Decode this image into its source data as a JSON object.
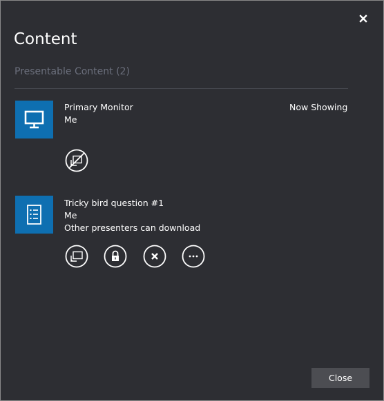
{
  "dialog": {
    "title": "Content",
    "close_icon": "close-x-icon"
  },
  "section": {
    "title": "Presentable Content (2)"
  },
  "items": [
    {
      "icon": "monitor-icon",
      "name": "Primary Monitor",
      "owner": "Me",
      "status": "Now Showing",
      "actions": [
        {
          "icon": "stop-presenting-icon"
        }
      ]
    },
    {
      "icon": "document-list-icon",
      "name": "Tricky bird question #1",
      "owner": "Me",
      "permission": "Other presenters can download",
      "actions": [
        {
          "icon": "present-icon"
        },
        {
          "icon": "lock-icon"
        },
        {
          "icon": "remove-icon"
        },
        {
          "icon": "more-icon"
        }
      ]
    }
  ],
  "footer": {
    "close_label": "Close"
  },
  "colors": {
    "background": "#2d2e33",
    "accent_tile": "#0e6fb1",
    "section_title": "#6b6f7c",
    "button_bg": "#4c4d52"
  }
}
